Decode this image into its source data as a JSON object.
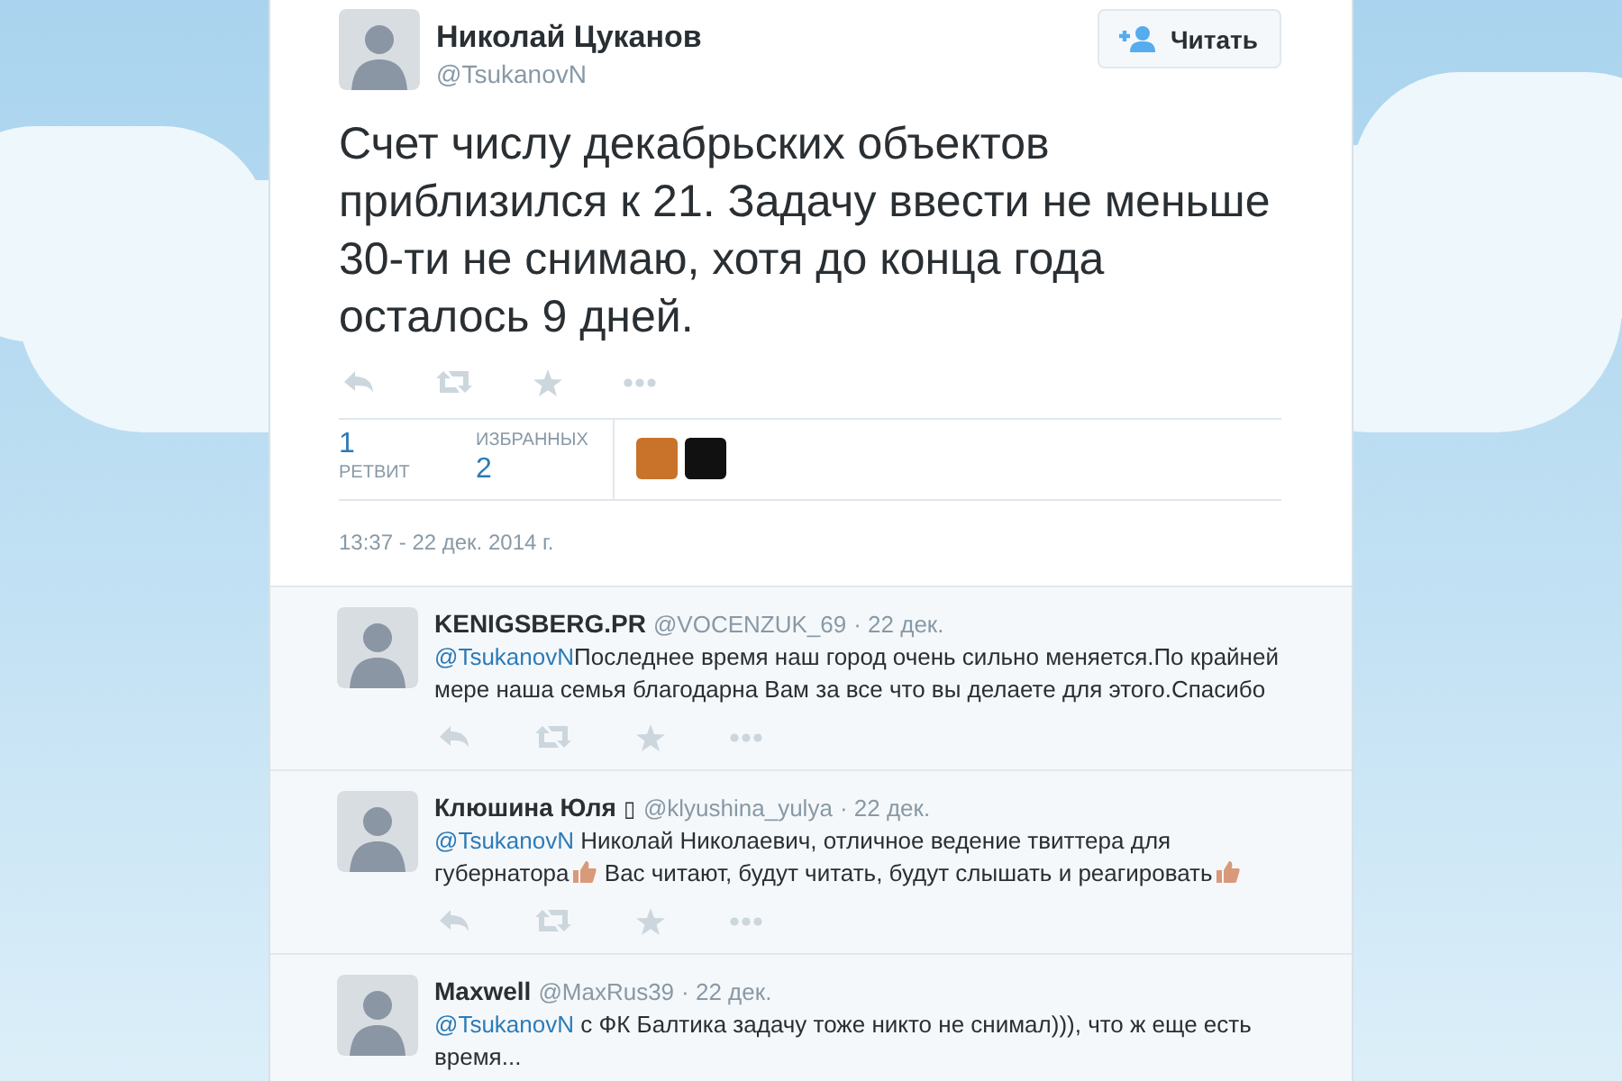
{
  "tweet": {
    "author": {
      "name": "Николай Цуканов",
      "handle": "@TsukanovN"
    },
    "follow_button": {
      "label": "Читать"
    },
    "text": "Счет числу декабрьских объектов приблизился к 21. Задачу ввести не меньше 30-ти не снимаю, хотя до конца года осталось 9 дней.",
    "stats": [
      {
        "count": "1",
        "label": "РЕТВИТ",
        "kind": "count_first"
      },
      {
        "count": "2",
        "label": "ИЗБРАННЫХ",
        "kind": "label_first"
      }
    ],
    "favoriters": [
      {
        "color": "#c9722a"
      },
      {
        "color": "#111111"
      }
    ],
    "timestamp": "13:37 - 22 дек. 2014 г."
  },
  "replies": [
    {
      "name": "KENIGSBERG.PR",
      "handle": "@VOCENZUK_69",
      "date": "· 22 дек.",
      "parts": [
        {
          "kind": "mention",
          "text": "@TsukanovN"
        },
        {
          "kind": "text",
          "text": "Последнее время наш  город очень сильно меняется.По крайней мере наша семья благодарна Вам за все что вы делаете для этого.Спасибо"
        }
      ]
    },
    {
      "name": "Клюшина Юля",
      "name_suffix": "▯",
      "handle": "@klyushina_yulya",
      "date": "· 22 дек.",
      "parts": [
        {
          "kind": "mention",
          "text": "@TsukanovN"
        },
        {
          "kind": "text",
          "text": " Николай Николаевич, отличное ведение твиттера для губернатора"
        },
        {
          "kind": "emoji"
        },
        {
          "kind": "text",
          "text": " Вас читают, будут читать, будут слышать и реагировать"
        },
        {
          "kind": "emoji"
        }
      ]
    },
    {
      "name": "Maxwell",
      "handle": "@MaxRus39",
      "date": "· 22 дек.",
      "parts": [
        {
          "kind": "mention",
          "text": "@TsukanovN"
        },
        {
          "kind": "text",
          "text": " с ФК Балтика задачу тоже никто не снимал))), что ж еще есть время..."
        }
      ]
    }
  ]
}
